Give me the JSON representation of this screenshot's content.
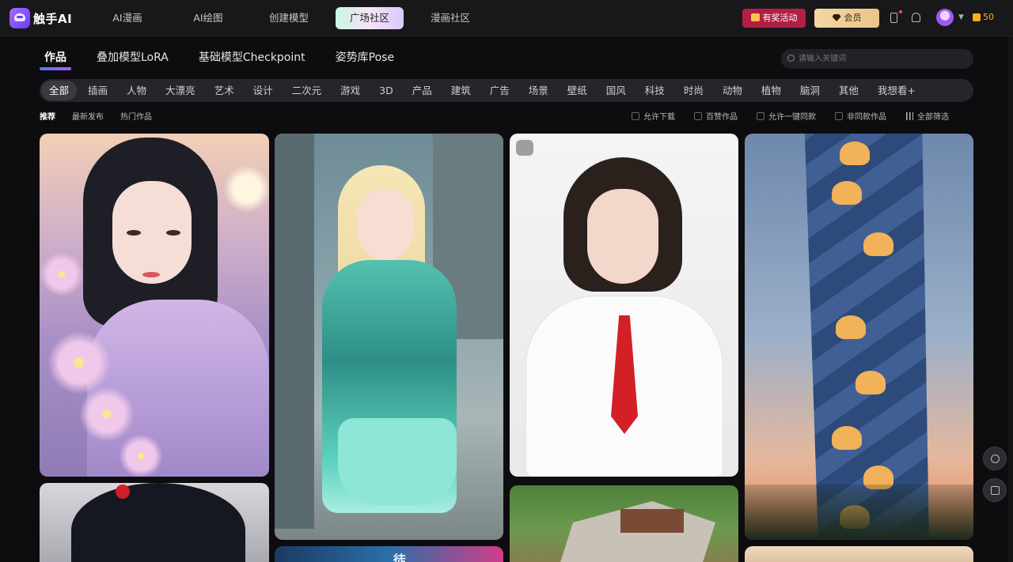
{
  "app": {
    "name": "触手AI"
  },
  "nav": [
    {
      "label": "AI漫画",
      "active": false
    },
    {
      "label": "AI绘图",
      "active": false
    },
    {
      "label": "创建模型",
      "active": false
    },
    {
      "label": "广场社区",
      "active": true
    },
    {
      "label": "漫画社区",
      "active": false
    }
  ],
  "header": {
    "promo_label": "有奖活动",
    "vip_label": "会员",
    "coin_count": "50",
    "icons": [
      "gift-icon",
      "diamond-icon",
      "phone-icon",
      "bell-icon",
      "avatar",
      "chevron-down-icon",
      "coin-icon"
    ],
    "colors": {
      "promo": "#b21f44",
      "vip": "#e9c58a",
      "coin": "#ffb020"
    }
  },
  "section_tabs": [
    {
      "label": "作品",
      "active": true
    },
    {
      "label": "叠加模型LoRA",
      "active": false
    },
    {
      "label": "基础模型Checkpoint",
      "active": false
    },
    {
      "label": "姿势库Pose",
      "active": false
    }
  ],
  "search": {
    "placeholder": "请输入关键词",
    "value": ""
  },
  "categories": [
    {
      "label": "全部",
      "active": true
    },
    {
      "label": "插画"
    },
    {
      "label": "人物"
    },
    {
      "label": "大漂亮"
    },
    {
      "label": "艺术"
    },
    {
      "label": "设计"
    },
    {
      "label": "二次元"
    },
    {
      "label": "游戏"
    },
    {
      "label": "3D"
    },
    {
      "label": "产品"
    },
    {
      "label": "建筑"
    },
    {
      "label": "广告"
    },
    {
      "label": "场景"
    },
    {
      "label": "壁纸"
    },
    {
      "label": "国风"
    },
    {
      "label": "科技"
    },
    {
      "label": "时尚"
    },
    {
      "label": "动物"
    },
    {
      "label": "植物"
    },
    {
      "label": "脑洞"
    },
    {
      "label": "其他"
    },
    {
      "label": "我想看+"
    }
  ],
  "sort": [
    {
      "label": "推荐",
      "active": true
    },
    {
      "label": "最新发布",
      "active": false
    },
    {
      "label": "热门作品",
      "active": false
    }
  ],
  "filters": [
    {
      "label": "允许下载",
      "checked": false
    },
    {
      "label": "百赞作品",
      "checked": false
    },
    {
      "label": "允许一键同款",
      "checked": false
    },
    {
      "label": "非同款作品",
      "checked": false
    }
  ],
  "filter_all_label": "全部筛选",
  "gallery_cards": [
    {
      "subject": "lily-girl-artwork"
    },
    {
      "subject": "cyber-armor-girl-artwork"
    },
    {
      "subject": "school-uniform-girl-artwork"
    },
    {
      "subject": "blue-lattice-tower-artwork"
    },
    {
      "subject": "ornate-hair-girl-artwork"
    },
    {
      "subject": "neon-sign-artwork",
      "visible_text": "徒"
    },
    {
      "subject": "isometric-courtyard-artwork"
    },
    {
      "subject": "portrait-artwork"
    }
  ],
  "floating_icons": [
    "lightbulb-icon",
    "share-icon"
  ]
}
